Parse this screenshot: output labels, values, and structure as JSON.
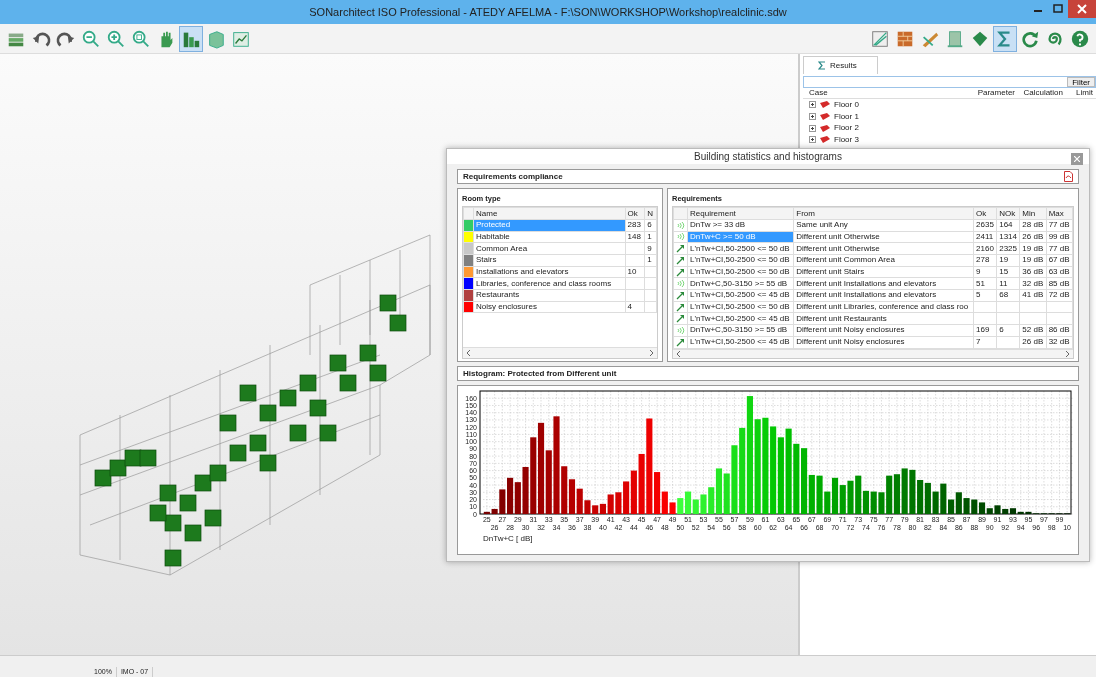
{
  "window": {
    "title": "SONarchitect ISO Professional - ATEDY AFELMA - F:\\SON\\WORKSHOP\\Workshop\\realclinic.sdw"
  },
  "toolbar_left": [
    {
      "selected": false
    },
    {
      "selected": false
    },
    {
      "selected": false
    },
    {
      "selected": false
    },
    {
      "selected": false
    },
    {
      "selected": false
    },
    {
      "selected": false
    },
    {
      "selected": true
    },
    {
      "selected": false
    },
    {
      "selected": false
    }
  ],
  "toolbar_right": [
    {
      "selected": false
    },
    {
      "selected": false
    },
    {
      "selected": false
    },
    {
      "selected": false
    },
    {
      "selected": false
    },
    {
      "selected": true
    },
    {
      "selected": false
    },
    {
      "selected": false
    },
    {
      "selected": false
    }
  ],
  "results": {
    "tab": "Results",
    "filter_button": "Filter",
    "columns": [
      "Case",
      "Parameter",
      "Calculation",
      "Limit"
    ],
    "items": [
      {
        "label": "Floor 0",
        "expanded": false
      },
      {
        "label": "Floor 1",
        "expanded": false
      },
      {
        "label": "Floor 2",
        "expanded": false
      },
      {
        "label": "Floor 3",
        "expanded": false
      }
    ]
  },
  "dialog": {
    "title": "Building statistics and histograms",
    "compliance_title": "Requirements compliance",
    "room_type": {
      "title": "Room type",
      "columns": [
        "Name",
        "Ok",
        "N"
      ],
      "rows": [
        {
          "color": "#33cc66",
          "name": "Protected",
          "ok": "283",
          "n": "6",
          "selected": true
        },
        {
          "color": "#ffff00",
          "name": "Habitable",
          "ok": "148",
          "n": "1",
          "selected": false
        },
        {
          "color": "#c8c8c8",
          "name": "Common Area",
          "ok": "",
          "n": "9",
          "selected": false
        },
        {
          "color": "#808080",
          "name": "Stairs",
          "ok": "",
          "n": "1",
          "selected": false
        },
        {
          "color": "#ff9933",
          "name": "Installations and elevators",
          "ok": "10",
          "n": "",
          "selected": false
        },
        {
          "color": "#0000ff",
          "name": "Libraries, conference and class rooms",
          "ok": "",
          "n": "",
          "selected": false
        },
        {
          "color": "#b04040",
          "name": "Restaurants",
          "ok": "",
          "n": "",
          "selected": false
        },
        {
          "color": "#ff0000",
          "name": "Noisy enclosures",
          "ok": "4",
          "n": "",
          "selected": false
        }
      ]
    },
    "requirements": {
      "title": "Requirements",
      "columns": [
        "Requirement",
        "From",
        "Ok",
        "NOk",
        "Min",
        "Max"
      ],
      "rows": [
        {
          "kind": "airborne",
          "requirement": "DnTw >= 33 dB",
          "from": "Same unit Any",
          "ok": "2635",
          "nok": "164",
          "min": "28 dB",
          "max": "77 dB",
          "selected": false
        },
        {
          "kind": "airborne",
          "requirement": "DnTw+C >= 50 dB",
          "from": "Different unit Otherwise",
          "ok": "2411",
          "nok": "1314",
          "min": "26 dB",
          "max": "99 dB",
          "selected": true
        },
        {
          "kind": "impact",
          "requirement": "L'nTw+CI,50-2500 <= 50 dB",
          "from": "Different unit Otherwise",
          "ok": "2160",
          "nok": "2325",
          "min": "19 dB",
          "max": "77 dB",
          "selected": false
        },
        {
          "kind": "impact",
          "requirement": "L'nTw+CI,50-2500 <= 50 dB",
          "from": "Different unit Common Area",
          "ok": "278",
          "nok": "19",
          "min": "19 dB",
          "max": "67 dB",
          "selected": false
        },
        {
          "kind": "impact",
          "requirement": "L'nTw+CI,50-2500 <= 50 dB",
          "from": "Different unit Stairs",
          "ok": "9",
          "nok": "15",
          "min": "36 dB",
          "max": "63 dB",
          "selected": false
        },
        {
          "kind": "airborne",
          "requirement": "DnTw+C,50-3150 >= 55 dB",
          "from": "Different unit Installations and elevators",
          "ok": "51",
          "nok": "11",
          "min": "32 dB",
          "max": "85 dB",
          "selected": false
        },
        {
          "kind": "impact",
          "requirement": "L'nTw+CI,50-2500 <= 45 dB",
          "from": "Different unit Installations and elevators",
          "ok": "5",
          "nok": "68",
          "min": "41 dB",
          "max": "72 dB",
          "selected": false
        },
        {
          "kind": "impact",
          "requirement": "L'nTw+CI,50-2500 <= 50 dB",
          "from": "Different unit Libraries, conference and class roo",
          "ok": "",
          "nok": "",
          "min": "",
          "max": "",
          "selected": false
        },
        {
          "kind": "impact",
          "requirement": "L'nTw+CI,50-2500 <= 45 dB",
          "from": "Different unit Restaurants",
          "ok": "",
          "nok": "",
          "min": "",
          "max": "",
          "selected": false
        },
        {
          "kind": "airborne",
          "requirement": "DnTw+C,50-3150 >= 55 dB",
          "from": "Different unit Noisy enclosures",
          "ok": "169",
          "nok": "6",
          "min": "52 dB",
          "max": "86 dB",
          "selected": false
        },
        {
          "kind": "impact",
          "requirement": "L'nTw+CI,50-2500 <= 45 dB",
          "from": "Different unit Noisy enclosures",
          "ok": "7",
          "nok": "",
          "min": "26 dB",
          "max": "32 dB",
          "selected": false
        }
      ]
    },
    "histogram": {
      "title": "Histogram: Protected from Different unit",
      "chart_data": {
        "type": "bar",
        "xlabel": "DnTw+C [ dB]",
        "grid": true,
        "categories": [
          "25",
          "26",
          "27",
          "28",
          "29",
          "30",
          "31",
          "32",
          "33",
          "34",
          "35",
          "36",
          "37",
          "38",
          "39",
          "40",
          "41",
          "42",
          "43",
          "44",
          "45",
          "46",
          "47",
          "48",
          "49",
          "50",
          "51",
          "52",
          "53",
          "54",
          "55",
          "56",
          "57",
          "58",
          "59",
          "60",
          "61",
          "62",
          "63",
          "64",
          "65",
          "66",
          "67",
          "68",
          "69",
          "70",
          "71",
          "72",
          "73",
          "74",
          "75",
          "76",
          "77",
          "78",
          "79",
          "80",
          "81",
          "82",
          "83",
          "84",
          "85",
          "86",
          "87",
          "88",
          "89",
          "90",
          "91",
          "92",
          "93",
          "94",
          "95",
          "96",
          "97",
          "98",
          "99",
          "10"
        ],
        "values": [
          3,
          7,
          34,
          50,
          44,
          65,
          106,
          126,
          88,
          135,
          66,
          48,
          35,
          19,
          12,
          14,
          27,
          30,
          45,
          60,
          83,
          132,
          58,
          31,
          16,
          22,
          31,
          20,
          27,
          37,
          63,
          56,
          95,
          119,
          163,
          131,
          133,
          121,
          106,
          118,
          97,
          91,
          54,
          53,
          31,
          50,
          40,
          46,
          53,
          32,
          31,
          30,
          53,
          55,
          63,
          61,
          47,
          43,
          31,
          42,
          20,
          30,
          22,
          20,
          16,
          8,
          12,
          7,
          8,
          3,
          3,
          1,
          1,
          1,
          1,
          1
        ],
        "ylim": [
          0,
          170
        ],
        "yticks": [
          0,
          10,
          20,
          30,
          40,
          50,
          60,
          70,
          80,
          90,
          100,
          110,
          120,
          130,
          140,
          150,
          160
        ]
      }
    }
  },
  "status_bar": {
    "zoom": "100%",
    "info": "IMO - 07"
  }
}
